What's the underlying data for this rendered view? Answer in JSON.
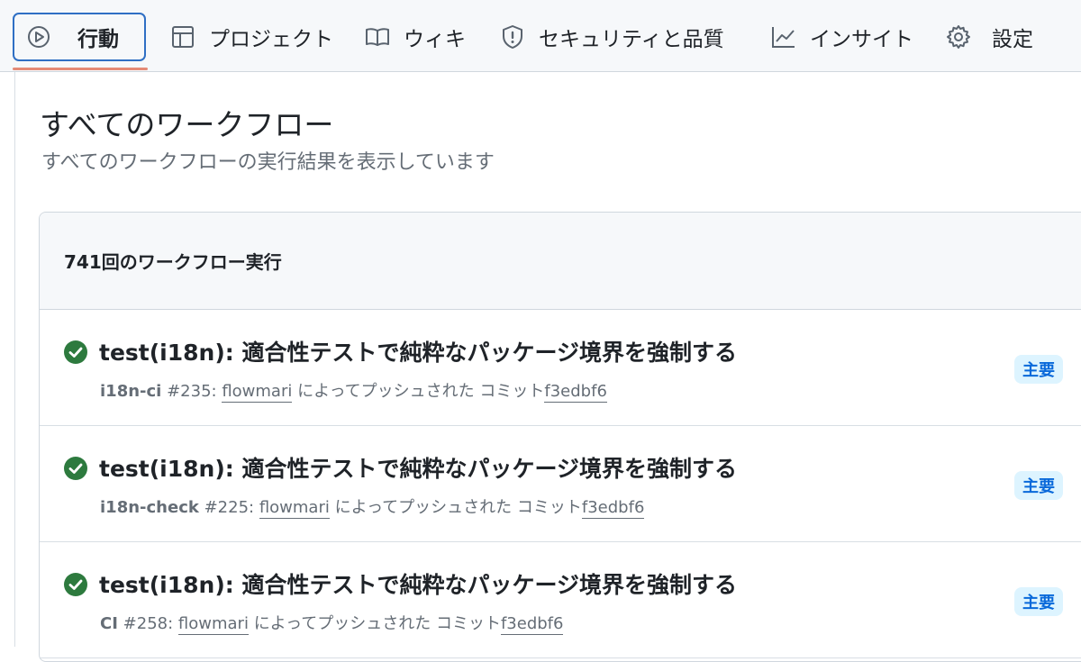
{
  "nav": {
    "tabs": [
      {
        "label": "行動",
        "icon": "play-icon",
        "selected": true
      },
      {
        "label": "プロジェクト",
        "icon": "table-icon",
        "selected": false
      },
      {
        "label": "ウィキ",
        "icon": "book-icon",
        "selected": false
      },
      {
        "label": "セキュリティと品質",
        "icon": "shield-icon",
        "selected": false
      },
      {
        "label": "インサイト",
        "icon": "graph-icon",
        "selected": false
      },
      {
        "label": "設定",
        "icon": "gear-icon",
        "selected": false
      }
    ]
  },
  "page": {
    "title": "すべてのワークフロー",
    "subtitle": "すべてのワークフローの実行結果を表示しています"
  },
  "runs": {
    "count_label": "741回のワークフロー実行",
    "items": [
      {
        "title": "test(i18n): 適合性テストで純粋なパッケージ境界を強制する",
        "workflow": "i18n-ci",
        "run_number": "#235:",
        "actor": "flowmari",
        "pushed_by_text": "によってプッシュされた コミット",
        "commit": "f3edbf6",
        "branch": "主要",
        "status": "success"
      },
      {
        "title": "test(i18n): 適合性テストで純粋なパッケージ境界を強制する",
        "workflow": "i18n-check",
        "run_number": "#225:",
        "actor": "flowmari",
        "pushed_by_text": "によってプッシュされた コミット",
        "commit": "f3edbf6",
        "branch": "主要",
        "status": "success"
      },
      {
        "title": "test(i18n): 適合性テストで純粋なパッケージ境界を強制する",
        "workflow": "CI",
        "run_number": "#258:",
        "actor": "flowmari",
        "pushed_by_text": "によってプッシュされた コミット",
        "commit": "f3edbf6",
        "branch": "主要",
        "status": "success"
      }
    ]
  },
  "colors": {
    "accent": "#2f6fc4",
    "success": "#1f883d",
    "tab_underline": "#e48a76",
    "badge_bg": "#ddf4ff",
    "badge_text": "#0969da"
  }
}
